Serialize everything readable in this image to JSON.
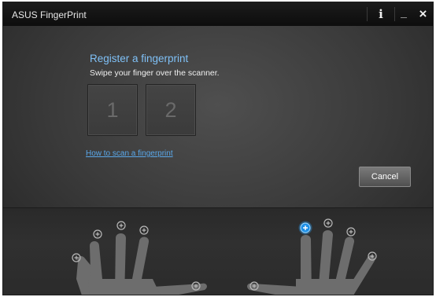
{
  "window": {
    "title": "ASUS FingerPrint",
    "buttons": {
      "info_icon": "i",
      "minimize_icon": "_",
      "close_icon": "×"
    }
  },
  "main": {
    "heading": "Register a fingerprint",
    "instruction": "Swipe your finger over the scanner.",
    "slots": [
      "1",
      "2"
    ],
    "help_link": "How to scan a fingerprint",
    "cancel_label": "Cancel"
  },
  "hands": {
    "selected_finger": "right-index",
    "accent_color": "#2aa3ff"
  }
}
